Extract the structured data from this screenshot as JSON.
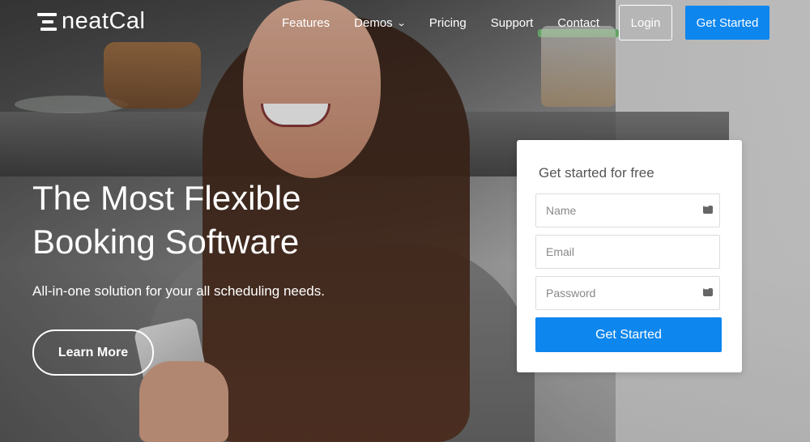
{
  "brand": {
    "name": "neatCal"
  },
  "nav": {
    "links": [
      "Features",
      "Demos",
      "Pricing",
      "Support",
      "Contact"
    ],
    "login_label": "Login",
    "cta_label": "Get Started"
  },
  "hero": {
    "headline_line1": "The Most Flexible",
    "headline_line2": "Booking Software",
    "subline": "All-in-one solution for your all scheduling needs.",
    "learn_more_label": "Learn More"
  },
  "signup": {
    "title": "Get started for free",
    "name_placeholder": "Name",
    "email_placeholder": "Email",
    "password_placeholder": "Password",
    "submit_label": "Get Started"
  },
  "colors": {
    "accent": "#0d86ee",
    "card_bg": "#ffffff",
    "text_light": "#ffffff"
  },
  "icons": {
    "demos_dropdown": "chevron-down-icon",
    "autofill": "password-manager-icon"
  }
}
